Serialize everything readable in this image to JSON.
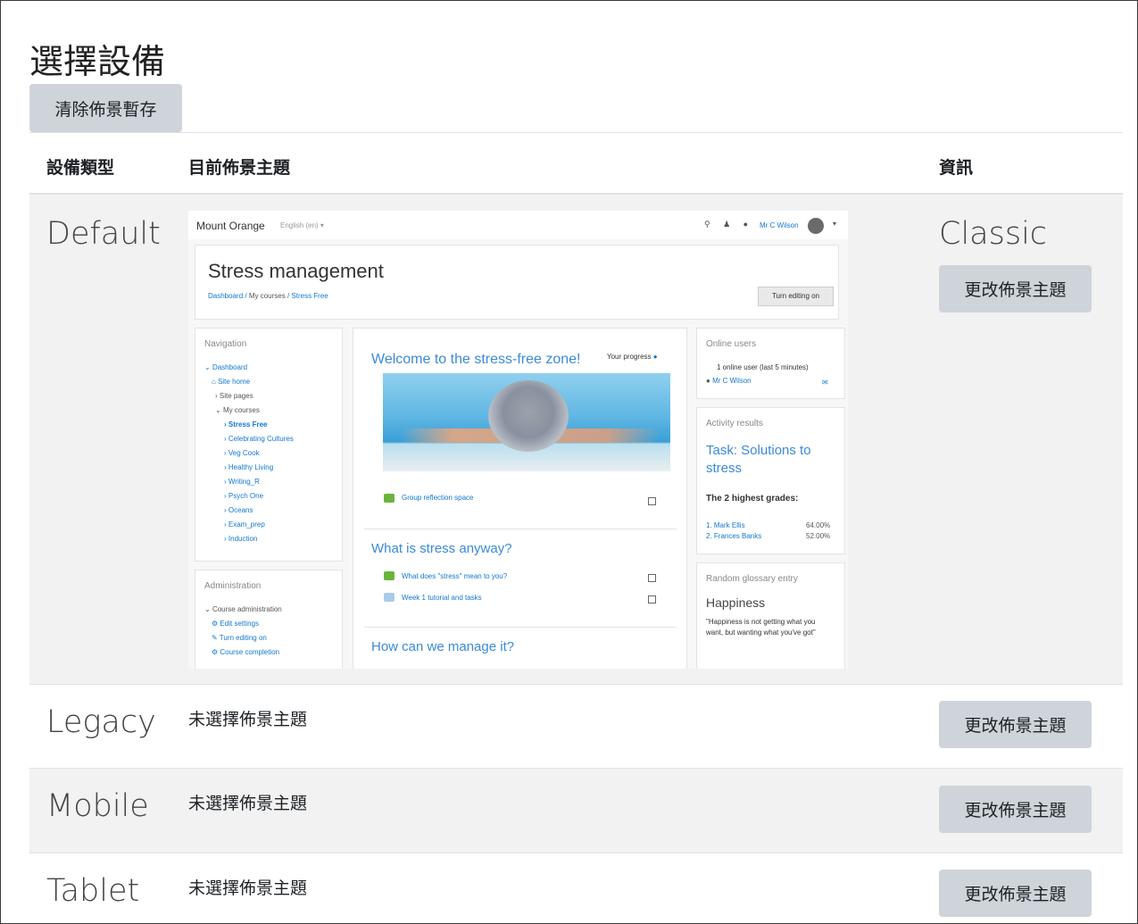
{
  "page": {
    "title": "選擇設備",
    "clear_button": "清除佈景暫存"
  },
  "table": {
    "headers": {
      "device_type": "設備類型",
      "current_theme": "目前佈景主題",
      "info": "資訊"
    },
    "rows": [
      {
        "device": "Default",
        "theme": "Classic",
        "button": "更改佈景主題"
      },
      {
        "device": "Legacy",
        "theme": "未選擇佈景主題",
        "button": "更改佈景主題"
      },
      {
        "device": "Mobile",
        "theme": "未選擇佈景主題",
        "button": "更改佈景主題"
      },
      {
        "device": "Tablet",
        "theme": "未選擇佈景主題",
        "button": "更改佈景主題"
      }
    ]
  },
  "preview": {
    "site_name": "Mount Orange",
    "language": "English (en) ▾",
    "user_name": "Mr C Wilson",
    "course_title": "Stress management",
    "breadcrumb": [
      "Dashboard",
      "My courses",
      "Stress Free"
    ],
    "edit_button": "Turn editing on",
    "navigation": {
      "title": "Navigation",
      "items": [
        "Dashboard",
        "Site home",
        "Site pages",
        "My courses",
        "Stress Free",
        "Celebrating Cultures",
        "Veg Cook",
        "Healthy Living",
        "Writing_R",
        "Psych One",
        "Oceans",
        "Exam_prep",
        "Induction"
      ]
    },
    "administration": {
      "title": "Administration",
      "items": [
        "Course administration",
        "Edit settings",
        "Turn editing on",
        "Course completion"
      ]
    },
    "main": {
      "welcome": "Welcome to the stress-free zone!",
      "progress": "Your progress",
      "activity1": "Group reflection space",
      "section2": "What is stress anyway?",
      "activity2": "What does \"stress\" mean to you?",
      "activity3": "Week 1 tutorial and tasks",
      "section3": "How can we manage it?"
    },
    "online_users": {
      "title": "Online users",
      "summary": "1 online user (last 5 minutes)",
      "user": "Mr C Wilson"
    },
    "activity_results": {
      "title": "Activity results",
      "task": "Task: Solutions to stress",
      "highest": "The 2 highest grades:",
      "grades": [
        {
          "name": "1. Mark Ellis",
          "score": "64.00%"
        },
        {
          "name": "2. Frances Banks",
          "score": "52.00%"
        }
      ]
    },
    "glossary": {
      "title": "Random glossary entry",
      "term": "Happiness",
      "quote": "\"Happiness is not getting what you want, but wanting what you've got\""
    }
  }
}
